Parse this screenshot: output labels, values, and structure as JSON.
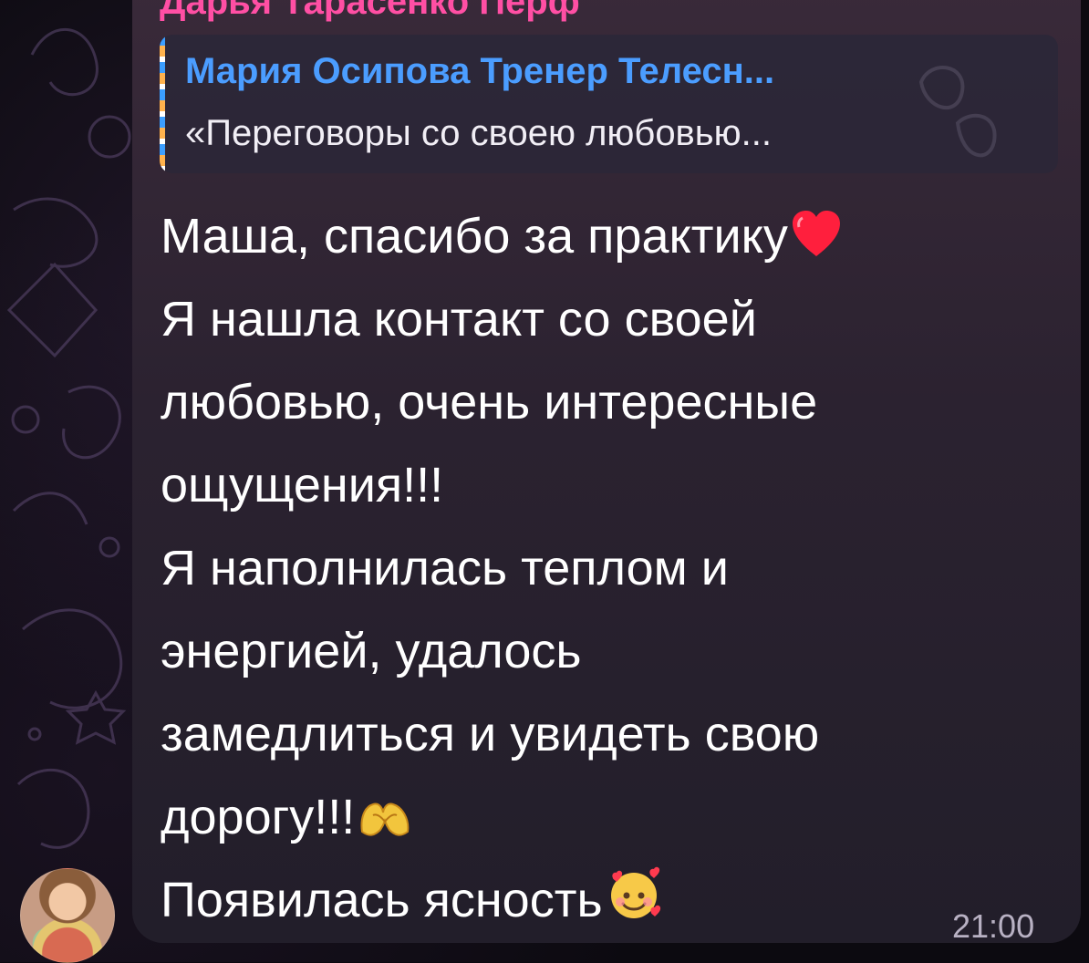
{
  "chat": {
    "sender_name": "Дарья Тарасенко Перф",
    "reply": {
      "author": "Мария Осипова Тренер Телесн...",
      "text": "«Переговоры со своею любовью..."
    },
    "message_lines": [
      "Маша, спасибо за практику",
      "Я нашла контакт со своей",
      "любовью, очень интересные",
      "ощущения!!!",
      "Я наполнилась теплом и",
      "энергией, удалось",
      "замедлиться и увидеть свою",
      "дорогу!!!",
      "Появилась ясность"
    ],
    "timestamp": "21:00",
    "emojis": {
      "line_1": "heart-emoji",
      "line_8": "hands-heart-emoji",
      "line_9": "smiling-face-hearts-emoji"
    }
  },
  "colors": {
    "sender_name": "#ff4fa4",
    "reply_author": "#4b9dff",
    "bubble": "#2b2230",
    "message_text": "#ffffff",
    "timestamp": "#b8b1c3"
  }
}
